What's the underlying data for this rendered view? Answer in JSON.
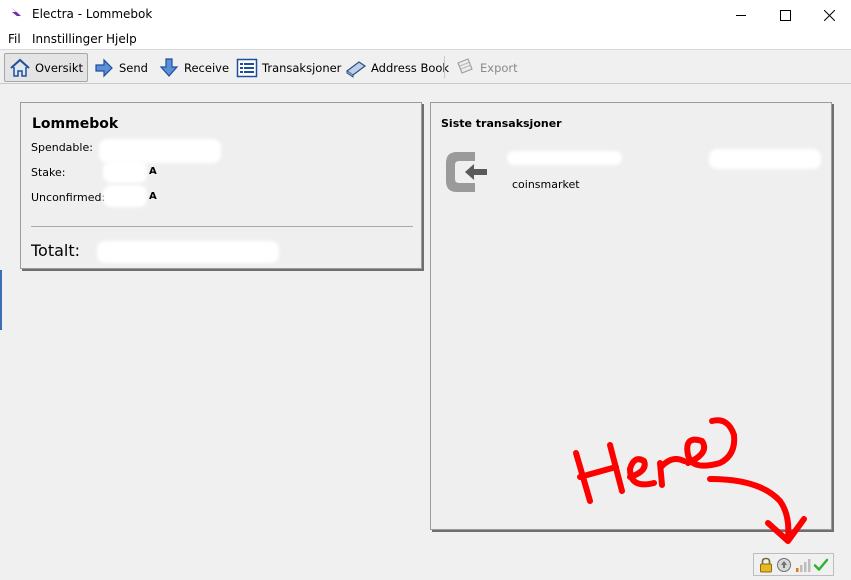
{
  "window": {
    "title": "Electra - Lommebok"
  },
  "menu": [
    "Fil",
    "Innstillinger",
    "Hjelp"
  ],
  "toolbar": {
    "overview": "Oversikt",
    "send": "Send",
    "receive": "Receive",
    "transactions": "Transaksjoner",
    "address_book": "Address Book",
    "export": "Export"
  },
  "wallet": {
    "title": "Lommebok",
    "spendable_label": "Spendable:",
    "stake_label": "Stake:",
    "unconfirmed_label": "Unconfirmed:",
    "total_label": "Totalt:",
    "unit_suffix": "A"
  },
  "recent": {
    "title": "Siste transaksjoner",
    "items": [
      {
        "label": "coinsmarket"
      }
    ]
  },
  "annotation": {
    "text": "Here",
    "color": "#ff0000"
  },
  "colors": {
    "accent": "#1e4e9c",
    "status_ok": "#2bb52b",
    "disabled": "#8a8a8a"
  },
  "status_icons": [
    "lock-icon",
    "staking-icon",
    "signal-icon",
    "sync-check-icon"
  ]
}
